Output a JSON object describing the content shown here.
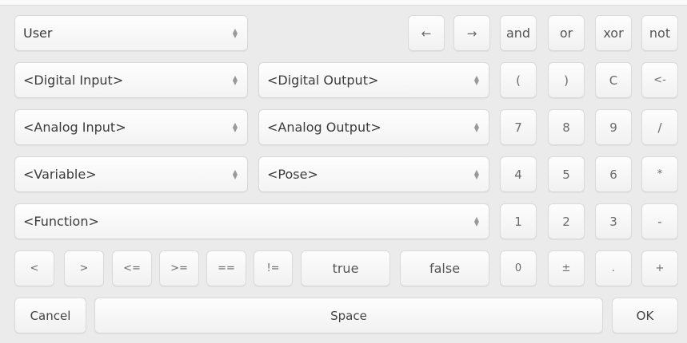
{
  "selects": {
    "user": "User",
    "digital_input": "<Digital Input>",
    "digital_output": "<Digital Output>",
    "analog_input": "<Analog Input>",
    "analog_output": "<Analog Output>",
    "variable": "<Variable>",
    "pose": "<Pose>",
    "function": "<Function>"
  },
  "arrows": {
    "left": "←",
    "right": "→"
  },
  "logic": {
    "and": "and",
    "or": "or",
    "xor": "xor",
    "not": "not"
  },
  "symbols": {
    "open_paren": "(",
    "close_paren": ")",
    "clear": "C",
    "backspace": "<-",
    "divide": "/",
    "multiply": "*",
    "minus": "-",
    "plus": "+",
    "plus_minus": "±",
    "dot": "."
  },
  "digits": {
    "d0": "0",
    "d1": "1",
    "d2": "2",
    "d3": "3",
    "d4": "4",
    "d5": "5",
    "d6": "6",
    "d7": "7",
    "d8": "8",
    "d9": "9"
  },
  "comparisons": {
    "lt": "<",
    "gt": ">",
    "le": "<=",
    "ge": ">=",
    "eq": "==",
    "ne": "!="
  },
  "booleans": {
    "true": "true",
    "false": "false"
  },
  "actions": {
    "cancel": "Cancel",
    "space": "Space",
    "ok": "OK"
  },
  "icons": {
    "select_arrows": "updown-arrows-icon"
  }
}
